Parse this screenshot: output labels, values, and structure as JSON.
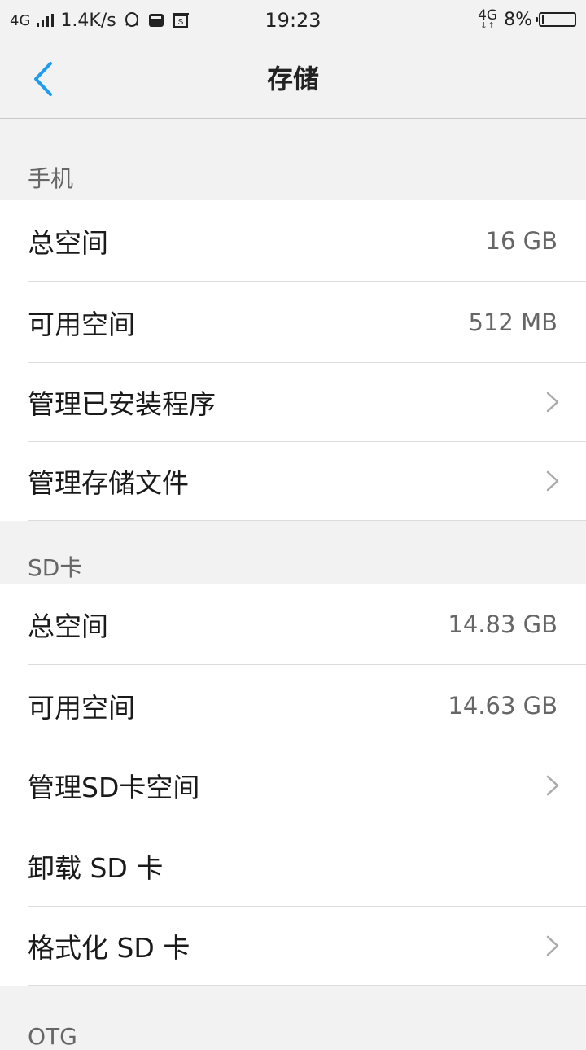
{
  "status_bar": {
    "network_left": "4G",
    "speed": "1.4K/s",
    "time": "19:23",
    "network_right": "4G",
    "network_right_arrows": "↓↑",
    "battery_percent": "8%",
    "battery_level": 0.08,
    "icons": [
      "signal-icon",
      "qq-icon",
      "message-icon",
      "screenshot-icon"
    ]
  },
  "header": {
    "title": "存储",
    "back_icon": "chevron-left-icon",
    "accent_color": "#1e9cf0"
  },
  "phone": {
    "header": "手机",
    "rows": [
      {
        "label": "总空间",
        "value": "16 GB"
      },
      {
        "label": "可用空间",
        "value": "512 MB"
      },
      {
        "label": "管理已安装程序",
        "chevron": true
      },
      {
        "label": "管理存储文件",
        "chevron": true
      }
    ]
  },
  "sd": {
    "header": "SD卡",
    "rows": [
      {
        "label": "总空间",
        "value": "14.83 GB"
      },
      {
        "label": "可用空间",
        "value": "14.63 GB"
      },
      {
        "label": "管理SD卡空间",
        "chevron": true
      },
      {
        "label": "卸载 SD 卡"
      },
      {
        "label": "格式化 SD 卡",
        "chevron": true
      }
    ]
  },
  "otg": {
    "header": "OTG"
  }
}
